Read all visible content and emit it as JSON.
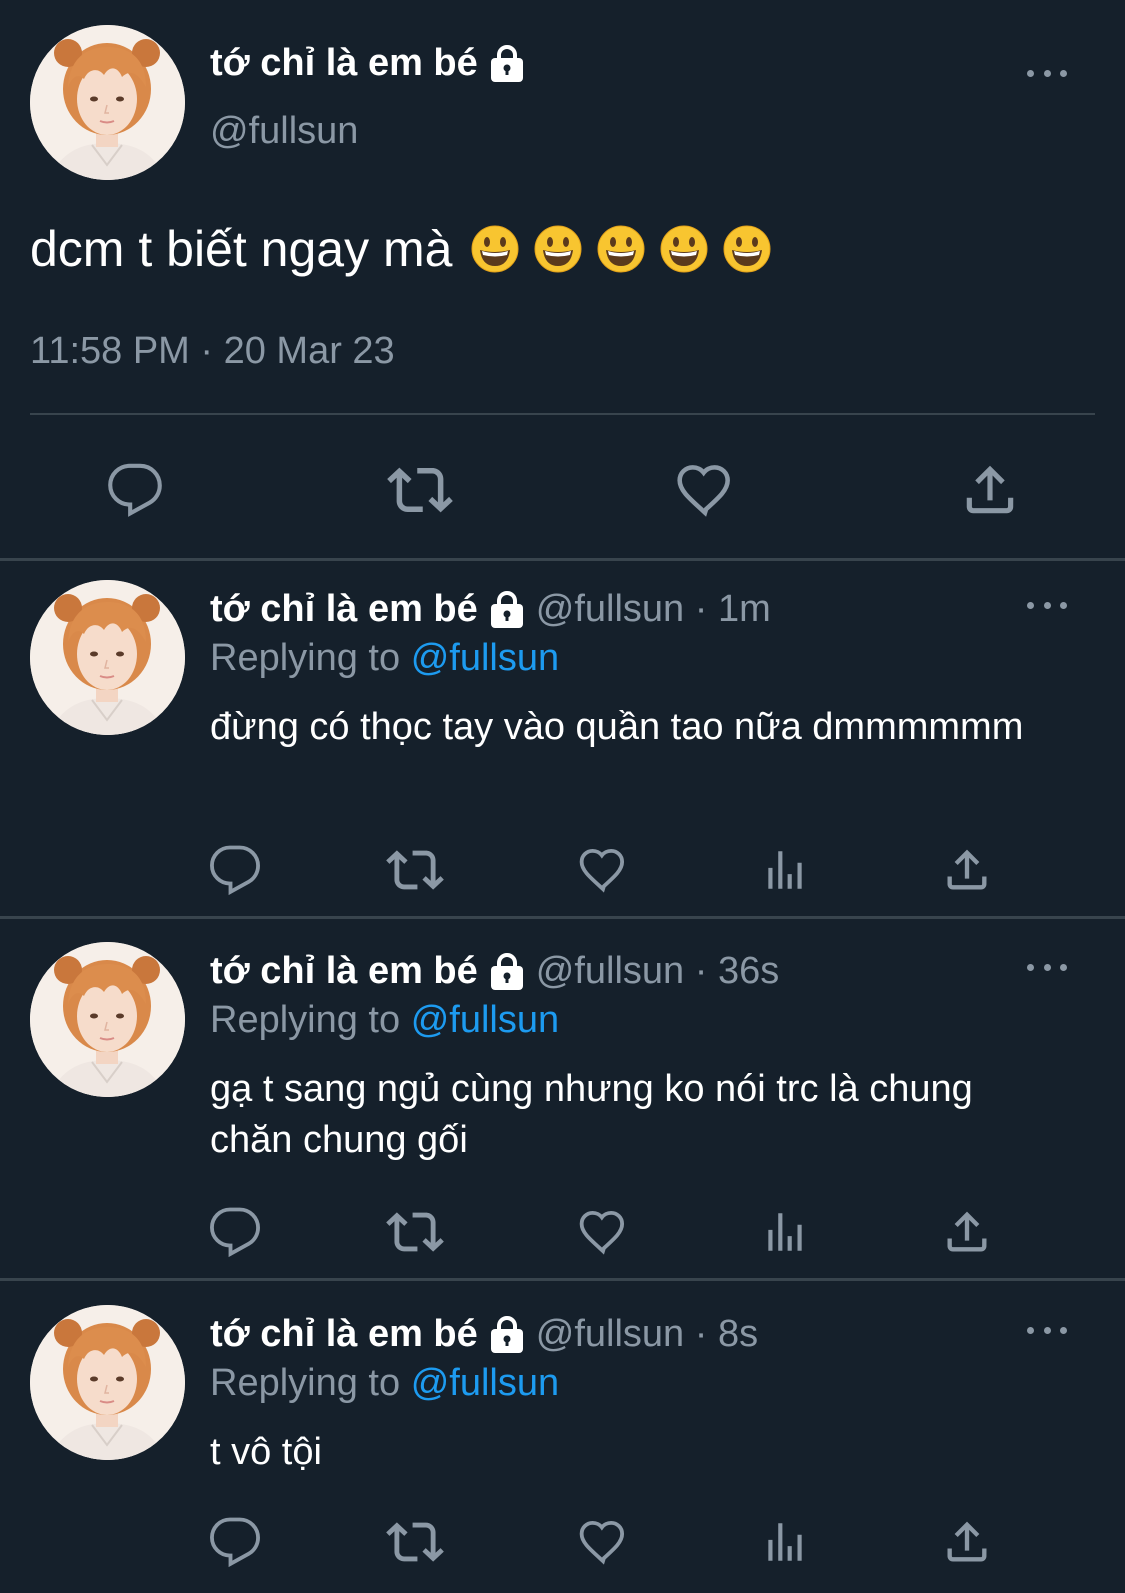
{
  "main_tweet": {
    "display_name": "tớ chỉ là em bé",
    "handle": "@fullsun",
    "text": "dcm t biết ngay mà",
    "emojis": [
      "grinning-face",
      "grinning-face",
      "grinning-face",
      "grinning-face",
      "grinning-face"
    ],
    "timestamp": "11:58 PM · 20 Mar 23",
    "actions": [
      "reply-icon",
      "retweet-icon",
      "like-icon",
      "share-icon"
    ]
  },
  "replies": [
    {
      "display_name": "tớ chỉ là em bé",
      "handle_time": "@fullsun · 1m",
      "replying_prefix": "Replying to",
      "replying_handle": "@fullsun",
      "text": "đừng có thọc tay vào quần tao nữa dmmmmmm"
    },
    {
      "display_name": "tớ chỉ là em bé",
      "handle_time": "@fullsun · 36s",
      "replying_prefix": "Replying to",
      "replying_handle": "@fullsun",
      "text": "gạ t sang ngủ cùng nhưng ko nói trc là chung chăn chung gối"
    },
    {
      "display_name": "tớ chỉ là em bé",
      "handle_time": "@fullsun · 8s",
      "replying_prefix": "Replying to",
      "replying_handle": "@fullsun",
      "text": "t vô tội"
    }
  ],
  "reply_actions": [
    "reply-icon",
    "retweet-icon",
    "like-icon",
    "analytics-icon",
    "share-icon"
  ],
  "colors": {
    "background": "#15202b",
    "text_primary": "#ffffff",
    "text_secondary": "#8b98a5",
    "accent": "#1d9bf0",
    "divider": "#38444d"
  }
}
